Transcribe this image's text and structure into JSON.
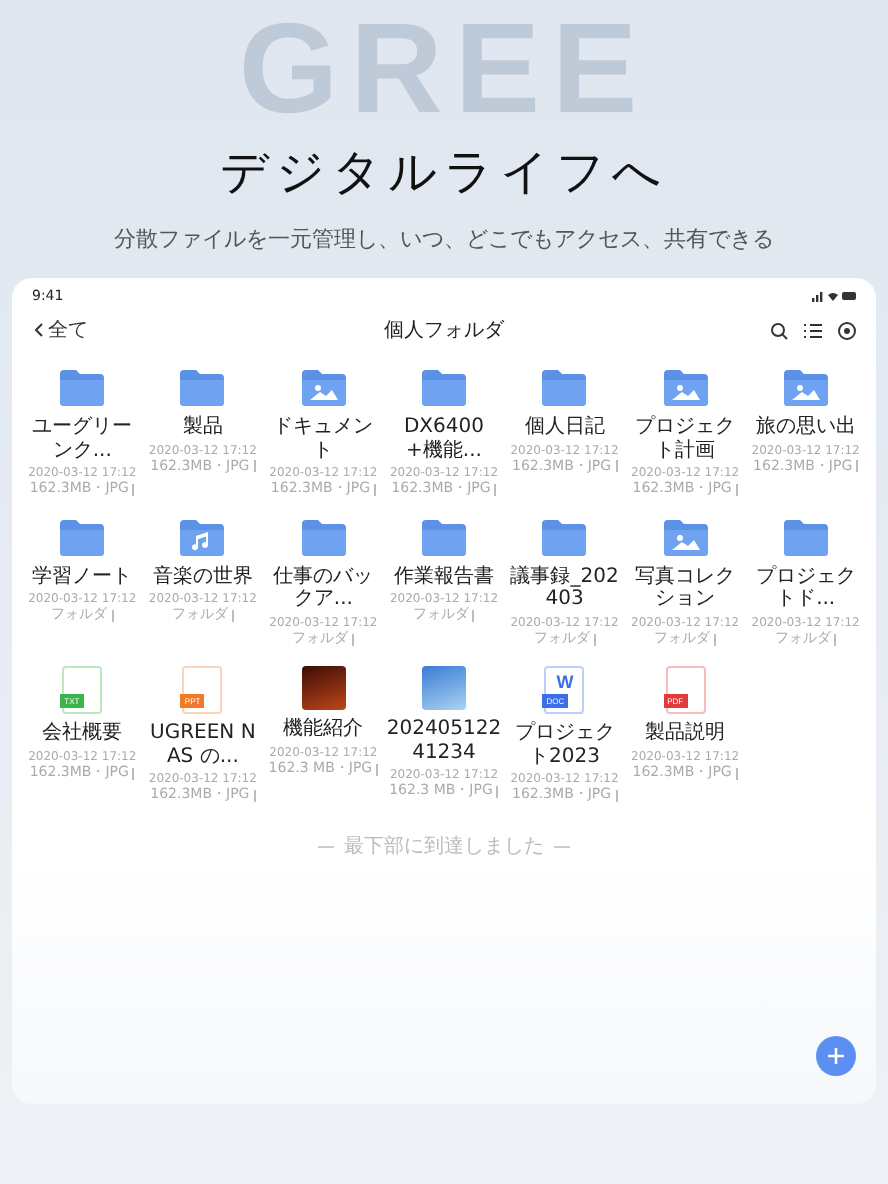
{
  "backdrop_text": "GREE",
  "headline": "デジタルライフへ",
  "subtitle": "分散ファイルを一元管理し、いつ、どこでもアクセス、共有できる",
  "status_bar": {
    "time": "9:41"
  },
  "nav": {
    "back": "全て",
    "title": "個人フォルダ"
  },
  "items": [
    {
      "kind": "folder",
      "name": "ユーグリーンク...",
      "date": "2020-03-12 17:12",
      "meta": "162.3MB・JPG"
    },
    {
      "kind": "folder",
      "name": "製品",
      "date": "2020-03-12 17:12",
      "meta": "162.3MB・JPG"
    },
    {
      "kind": "image-folder",
      "name": "ドキュメント",
      "date": "2020-03-12 17:12",
      "meta": "162.3MB・JPG"
    },
    {
      "kind": "folder",
      "name": "DX6400+機能...",
      "date": "2020-03-12 17:12",
      "meta": "162.3MB・JPG"
    },
    {
      "kind": "folder",
      "name": "個人日記",
      "date": "2020-03-12 17:12",
      "meta": "162.3MB・JPG"
    },
    {
      "kind": "image-folder",
      "name": "プロジェクト計画",
      "date": "2020-03-12 17:12",
      "meta": "162.3MB・JPG"
    },
    {
      "kind": "image-folder",
      "name": "旅の思い出",
      "date": "2020-03-12 17:12",
      "meta": "162.3MB・JPG"
    },
    {
      "kind": "folder",
      "name": "学習ノート",
      "date": "2020-03-12 17:12",
      "meta": "フォルダ"
    },
    {
      "kind": "music-folder",
      "name": "音楽の世界",
      "date": "2020-03-12 17:12",
      "meta": "フォルダ"
    },
    {
      "kind": "folder",
      "name": "仕事のバックア...",
      "date": "2020-03-12 17:12",
      "meta": "フォルダ"
    },
    {
      "kind": "folder",
      "name": "作業報告書",
      "date": "2020-03-12 17:12",
      "meta": "フォルダ"
    },
    {
      "kind": "folder",
      "name": "議事録_202403",
      "date": "2020-03-12 17:12",
      "meta": "フォルダ"
    },
    {
      "kind": "image-folder",
      "name": "写真コレクション",
      "date": "2020-03-12 17:12",
      "meta": "フォルダ"
    },
    {
      "kind": "folder",
      "name": "プロジェクトド...",
      "date": "2020-03-12 17:12",
      "meta": "フォルダ"
    },
    {
      "kind": "file",
      "badge": "TXT",
      "color": "#3bb54a",
      "name": "会社概要",
      "date": "2020-03-12 17:12",
      "meta": "162.3MB・JPG"
    },
    {
      "kind": "file",
      "badge": "PPT",
      "color": "#f07a2a",
      "name": "UGREEN NAS の...",
      "date": "2020-03-12 17:12",
      "meta": "162.3MB・JPG"
    },
    {
      "kind": "photo",
      "name": "機能紹介",
      "date": "2020-03-12 17:12",
      "meta": "162.3 MB・JPG"
    },
    {
      "kind": "photo",
      "name": "20240512241234",
      "date": "2020-03-12 17:12",
      "meta": "162.3 MB・JPG"
    },
    {
      "kind": "file",
      "badge": "DOC",
      "letter": "W",
      "color": "#3a6fe8",
      "name": "プロジェクト2023",
      "date": "2020-03-12 17:12",
      "meta": "162.3MB・JPG"
    },
    {
      "kind": "file",
      "badge": "PDF",
      "color": "#e23b3b",
      "name": "製品説明",
      "date": "2020-03-12 17:12",
      "meta": "162.3MB・JPG"
    }
  ],
  "end_note": "最下部に到達しました"
}
